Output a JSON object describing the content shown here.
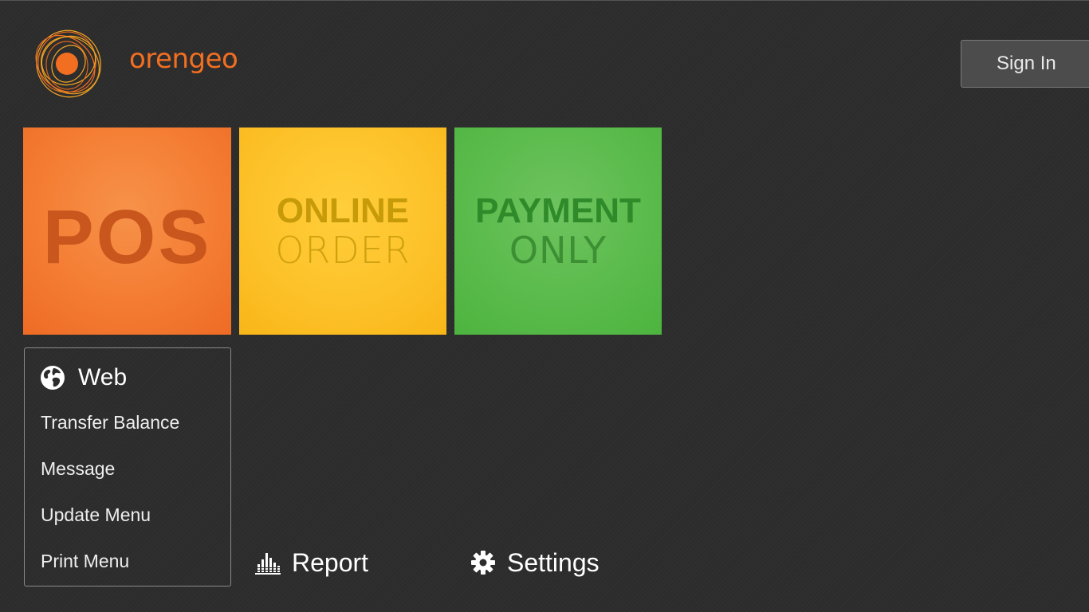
{
  "brand": {
    "name": "orengeo",
    "trademark": "™",
    "colors": {
      "primary": "#f26f21",
      "accent": "#f5a623"
    }
  },
  "header": {
    "sign_in_label": "Sign In"
  },
  "tiles": {
    "pos": {
      "label": "POS",
      "color": "#f47d33"
    },
    "online_order": {
      "line1": "ONLINE",
      "line2": "ORDER",
      "color": "#fdc22a"
    },
    "payment_only": {
      "line1": "PAYMENT",
      "line2": "ONLY",
      "color": "#5bbb4c"
    }
  },
  "web_menu": {
    "title": "Web",
    "icon": "globe-icon",
    "items": [
      "Transfer Balance",
      "Message",
      "Update Menu",
      "Print Menu"
    ]
  },
  "bottom_actions": {
    "report": {
      "label": "Report",
      "icon": "bar-chart-icon"
    },
    "settings": {
      "label": "Settings",
      "icon": "gear-icon"
    }
  }
}
